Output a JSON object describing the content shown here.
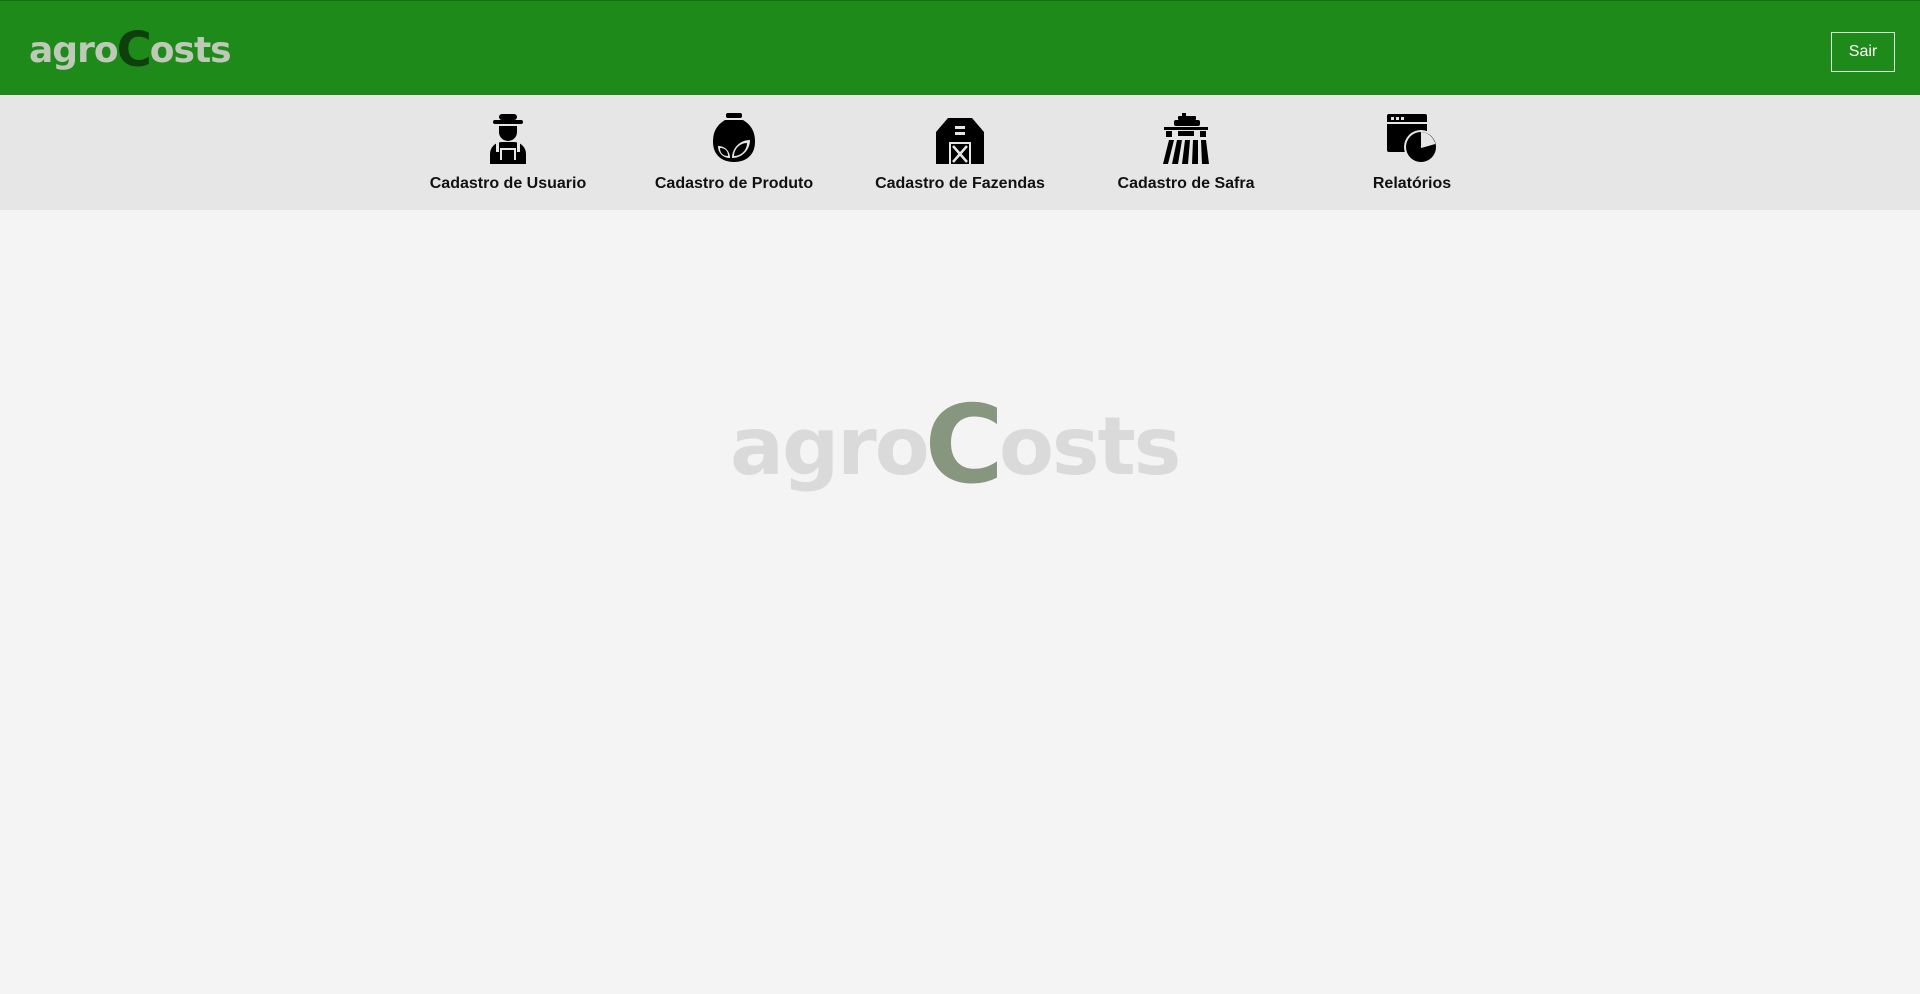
{
  "header": {
    "brand_part1": "agro",
    "brand_c": "C",
    "brand_part2": "osts",
    "logout_label": "Sair",
    "background": "#1e8a1a"
  },
  "nav": {
    "items": [
      {
        "label": "Cadastro de Usuario",
        "icon": "farmer-icon"
      },
      {
        "label": "Cadastro de Produto",
        "icon": "seed-bag-icon"
      },
      {
        "label": "Cadastro de Fazendas",
        "icon": "barn-icon"
      },
      {
        "label": "Cadastro de Safra",
        "icon": "tractor-field-icon"
      },
      {
        "label": "Relatórios",
        "icon": "report-chart-icon"
      }
    ]
  },
  "watermark": {
    "part1": "agro",
    "c": "C",
    "part2": "osts"
  }
}
